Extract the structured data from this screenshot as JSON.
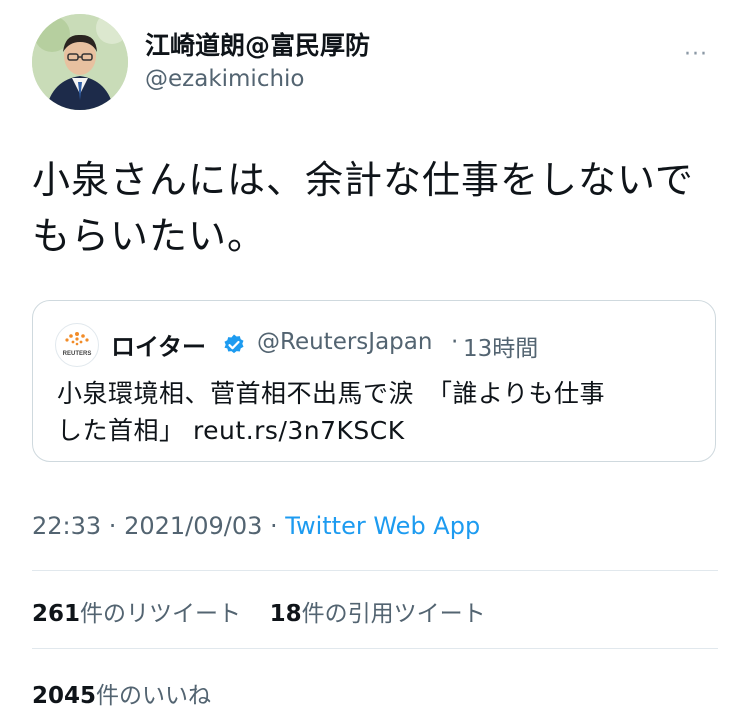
{
  "author": {
    "display_name": "江崎道朗@富民厚防",
    "handle": "@ezakimichio"
  },
  "more_menu_label": "···",
  "tweet": {
    "line1": "小泉さんには、余計な仕事をしないで",
    "line2": "もらいたい。"
  },
  "quoted_tweet": {
    "logo_text": "REUTERS",
    "display_name": "ロイター",
    "handle": "@ReutersJapan",
    "separator": "·",
    "time": "13時間",
    "line1": "小泉環境相、菅首相不出馬で涙　「誰よりも仕事",
    "line2": "した首相」 reut.rs/3n7KSCK"
  },
  "meta": {
    "time": "22:33",
    "sep1": " · ",
    "date": "2021/09/03",
    "sep2": " · ",
    "source": "Twitter Web App"
  },
  "stats": {
    "retweets_count": "261",
    "retweets_label": "件のリツイート",
    "quotes_count": "18",
    "quotes_label": "件の引用ツイート",
    "likes_count": "2045",
    "likes_label": "件のいいね"
  },
  "colors": {
    "link": "#1d9bf0",
    "secondary_text": "#536471",
    "verified": "#1d9bf0",
    "reuters_orange": "#f28c28"
  }
}
